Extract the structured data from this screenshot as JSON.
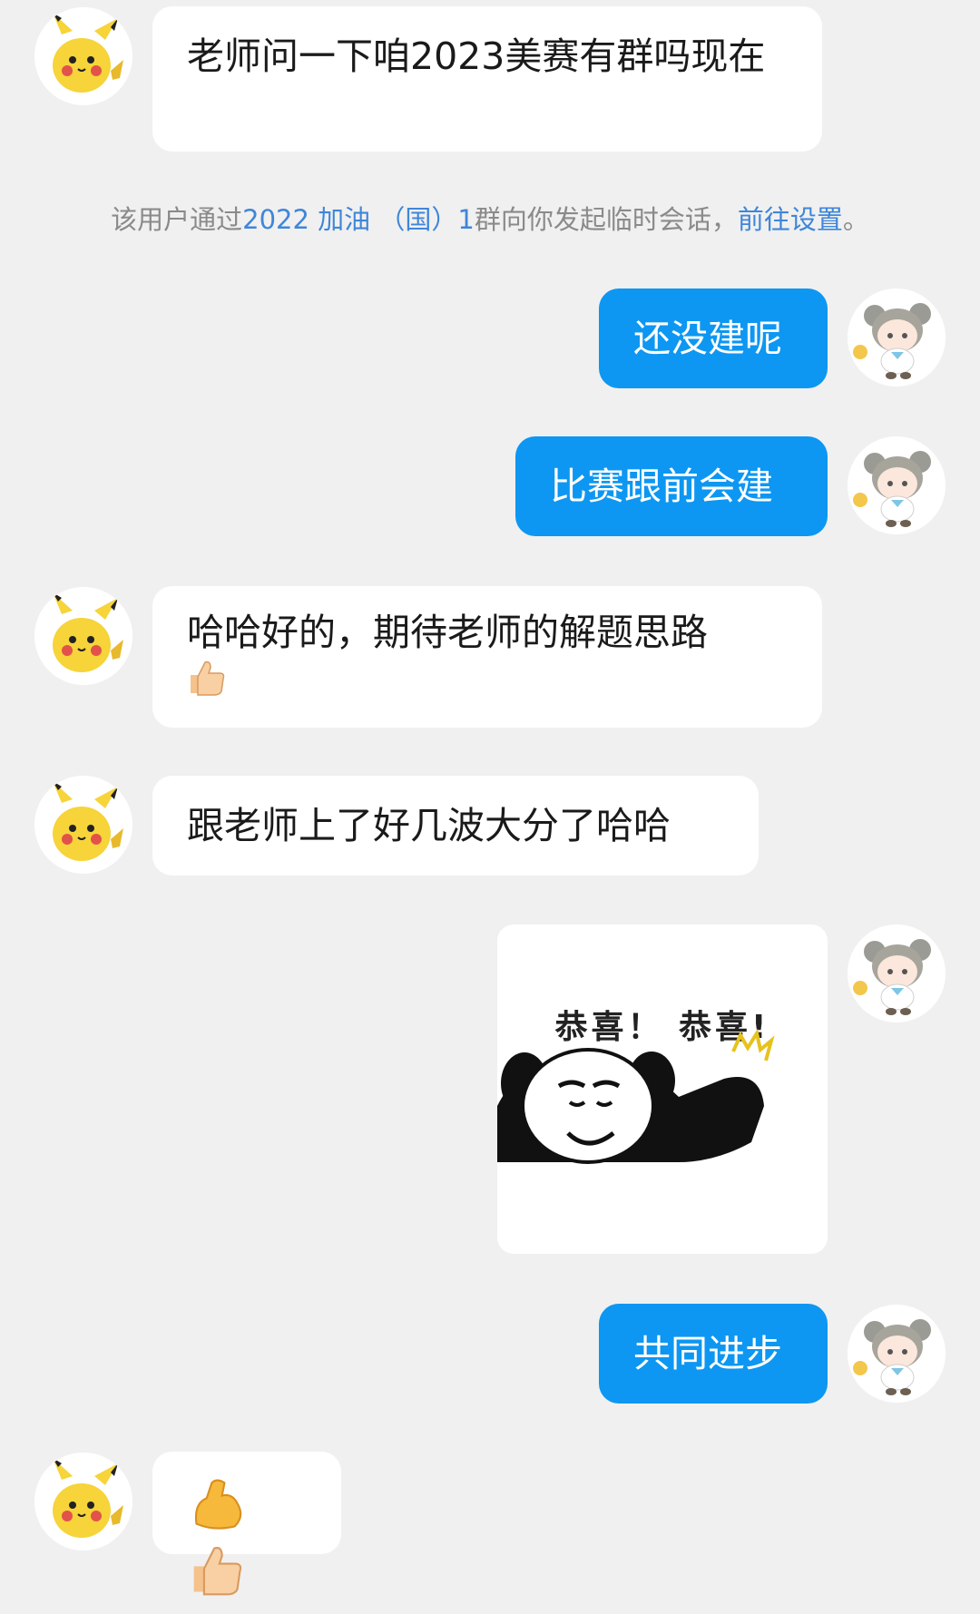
{
  "messages": {
    "m1": "老师问一下咱2023美赛有群吗现在",
    "m2": "还没建呢",
    "m3": "比赛跟前会建",
    "m4": "哈哈好的，期待老师的解题思路",
    "m5": "跟老师上了好几波大分了哈哈",
    "m6": "共同进步"
  },
  "notice": {
    "prefix": "该用户通过",
    "group_link": "2022 加油 （国）1",
    "middle": "群向你发起临时会话，",
    "settings_link": "前往设置",
    "suffix": "。"
  },
  "sticker": {
    "text": "恭喜！ 恭喜!"
  },
  "icons": {
    "other_avatar": "pikachu-avatar",
    "self_avatar": "chibi-girl-avatar",
    "thumbs_up": "thumbs-up-emoji",
    "flexed_biceps": "flexed-biceps-emoji"
  },
  "colors": {
    "background": "#f0f0f0",
    "outgoing_bubble": "#0d97f2",
    "incoming_bubble": "#ffffff",
    "link": "#3f86d9"
  }
}
